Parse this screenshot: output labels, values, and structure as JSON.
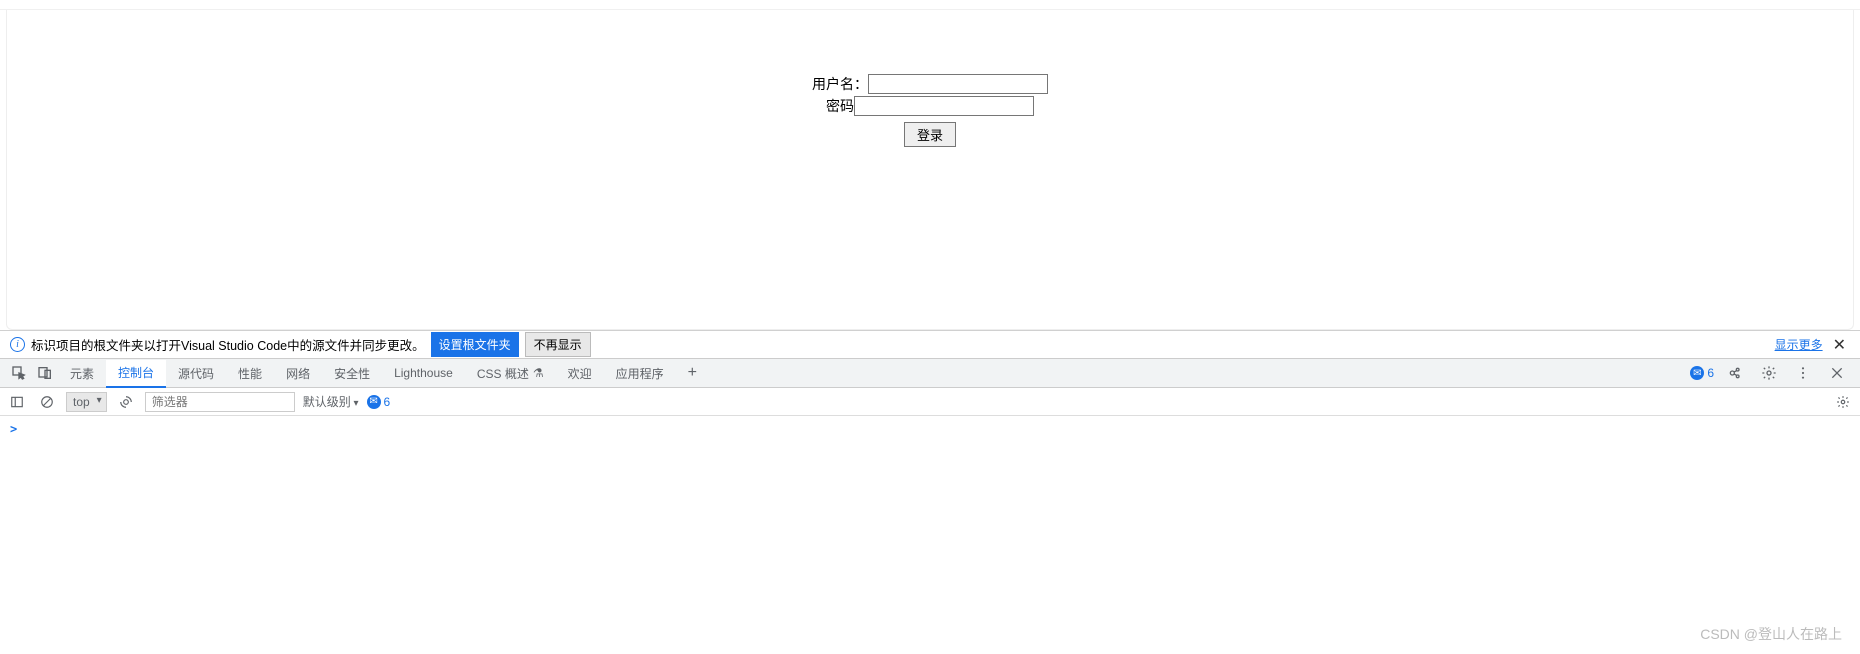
{
  "form": {
    "username_label": "用户名：",
    "password_label": "密码",
    "submit_label": "登录"
  },
  "infobar": {
    "message": "标识项目的根文件夹以打开Visual Studio Code中的源文件并同步更改。",
    "set_root_btn": "设置根文件夹",
    "dismiss_btn": "不再显示",
    "show_more": "显示更多"
  },
  "tabs": {
    "elements": "元素",
    "console": "控制台",
    "sources": "源代码",
    "performance": "性能",
    "network": "网络",
    "security": "安全性",
    "lighthouse": "Lighthouse",
    "css_overview": "CSS 概述",
    "css_overview_badge": "⚗",
    "welcome": "欢迎",
    "application": "应用程序"
  },
  "tabs_right": {
    "issue_count": "6"
  },
  "console_toolbar": {
    "context": "top",
    "filter_placeholder": "筛选器",
    "level": "默认级别",
    "msg_count": "6"
  },
  "console": {
    "prompt": ">"
  },
  "watermark": "CSDN @登山人在路上"
}
